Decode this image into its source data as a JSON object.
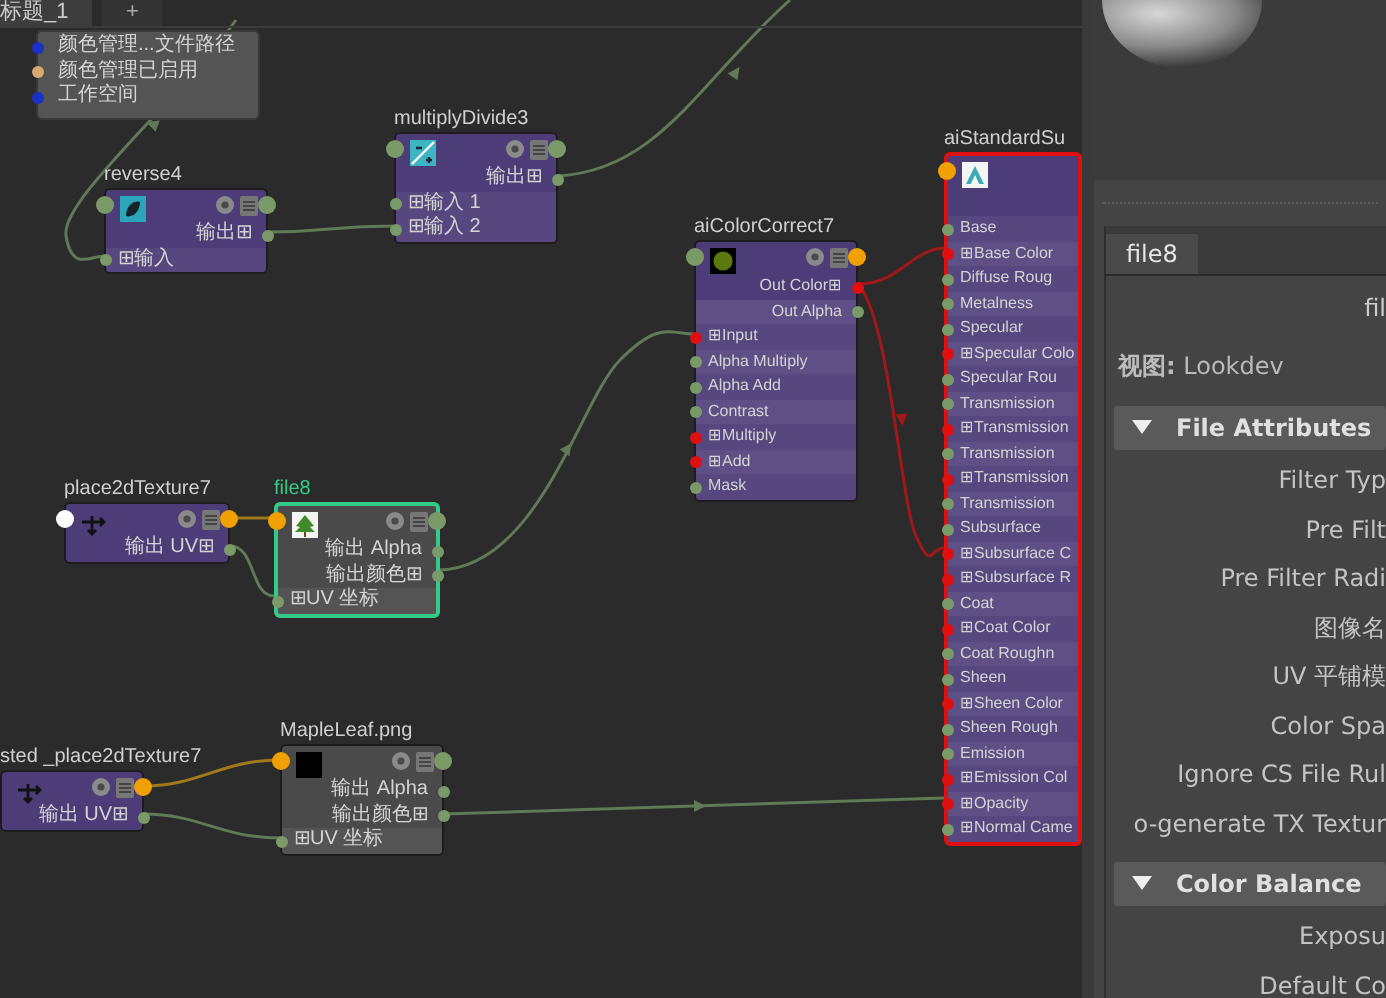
{
  "tabs": [
    {
      "label": "标题_1",
      "selected": true
    },
    {
      "label": "+",
      "selected": false
    }
  ],
  "nodes": [
    {
      "kind": "colorManagement",
      "selected": false,
      "inputs": [
        {
          "label": "颜色管理...文件路径",
          "color": "#1a30c8"
        },
        {
          "label": "颜色管理已启用",
          "color": "#d8a870"
        },
        {
          "label": "工作空间",
          "color": "#1a30c8"
        }
      ]
    },
    {
      "kind": "reverse",
      "title": "reverse4",
      "selected": false,
      "in_port": {
        "color": "#7a9a68"
      },
      "out_port": {
        "color": "#7a9a68"
      },
      "outputs": [
        {
          "label": "输出⊞",
          "color": "#7a9a68"
        }
      ],
      "inputs": [
        {
          "label": "⊞输入",
          "color": "#7a9a68"
        }
      ]
    },
    {
      "kind": "multiplyDivide",
      "title": "multiplyDivide3",
      "selected": false,
      "in_port": {
        "color": "#7a9a68"
      },
      "out_port": {
        "color": "#7a9a68"
      },
      "outputs": [
        {
          "label": "输出⊞",
          "color": "#7a9a68"
        }
      ],
      "inputs": [
        {
          "label": "⊞输入 1",
          "color": "#7a9a68"
        },
        {
          "label": "⊞输入 2",
          "color": "#7a9a68"
        }
      ]
    },
    {
      "kind": "place2dTexture",
      "title": "place2dTexture7",
      "selected": false,
      "in_port": {
        "color": "#ffffff"
      },
      "out_port": {
        "color": "#f0a000"
      },
      "outputs": [
        {
          "label": "输出 UV⊞",
          "color": "#7a9a68"
        }
      ]
    },
    {
      "kind": "file",
      "title": "file8",
      "selected": true,
      "in_port": {
        "color": "#f0a000"
      },
      "out_port": {
        "color": "#7a9a68"
      },
      "outputs": [
        {
          "label": "输出 Alpha",
          "color": "#7a9a68"
        },
        {
          "label": "输出颜色⊞",
          "color": "#7a9a68"
        }
      ],
      "inputs": [
        {
          "label": "⊞UV 坐标",
          "color": "#7a9a68"
        }
      ]
    },
    {
      "kind": "aiColorCorrect",
      "title": "aiColorCorrect7",
      "selected": false,
      "in_port": {
        "color": "#7a9a68"
      },
      "out_port": {
        "color": "#f0a000"
      },
      "outputs": [
        {
          "label": "Out Color⊞",
          "color": "#e01010"
        },
        {
          "label": "Out Alpha",
          "color": "#7a9a68"
        }
      ],
      "inputs": [
        {
          "label": "⊞Input",
          "color": "#e01010"
        },
        {
          "label": "Alpha Multiply",
          "color": "#7a9a68"
        },
        {
          "label": "Alpha Add",
          "color": "#7a9a68"
        },
        {
          "label": "Contrast",
          "color": "#7a9a68"
        },
        {
          "label": "⊞Multiply",
          "color": "#e01010"
        },
        {
          "label": "⊞Add",
          "color": "#e01010"
        },
        {
          "label": "Mask",
          "color": "#7a9a68"
        }
      ]
    },
    {
      "kind": "aiStandardSurface",
      "title": "aiStandardSu",
      "selected": false,
      "color": "#e01010",
      "in_port": {
        "color": "#f0a000"
      },
      "inputs": [
        {
          "label": "Base",
          "color": "#7a9a68"
        },
        {
          "label": "⊞Base Color",
          "color": "#e01010"
        },
        {
          "label": "Diffuse Roug",
          "color": "#7a9a68"
        },
        {
          "label": "Metalness",
          "color": "#7a9a68"
        },
        {
          "label": "Specular",
          "color": "#7a9a68"
        },
        {
          "label": "⊞Specular Colo",
          "color": "#e01010"
        },
        {
          "label": "Specular Rou",
          "color": "#7a9a68"
        },
        {
          "label": "Transmission",
          "color": "#7a9a68"
        },
        {
          "label": "⊞Transmission",
          "color": "#e01010"
        },
        {
          "label": "Transmission",
          "color": "#7a9a68"
        },
        {
          "label": "⊞Transmission",
          "color": "#e01010"
        },
        {
          "label": "Transmission",
          "color": "#7a9a68"
        },
        {
          "label": "Subsurface",
          "color": "#7a9a68"
        },
        {
          "label": "⊞Subsurface C",
          "color": "#e01010"
        },
        {
          "label": "⊞Subsurface R",
          "color": "#e01010"
        },
        {
          "label": "Coat",
          "color": "#7a9a68"
        },
        {
          "label": "⊞Coat Color",
          "color": "#e01010"
        },
        {
          "label": "Coat Roughn",
          "color": "#7a9a68"
        },
        {
          "label": "Sheen",
          "color": "#7a9a68"
        },
        {
          "label": "⊞Sheen Color",
          "color": "#e01010"
        },
        {
          "label": "Sheen Rough",
          "color": "#7a9a68"
        },
        {
          "label": "Emission",
          "color": "#7a9a68"
        },
        {
          "label": "⊞Emission Col",
          "color": "#e01010"
        },
        {
          "label": "⊞Opacity",
          "color": "#e01010"
        },
        {
          "label": "⊞Normal Came",
          "color": "#7a9a68"
        }
      ]
    },
    {
      "kind": "place2dTexture",
      "title": "sted _place2dTexture7",
      "selected": false,
      "out_port": {
        "color": "#f0a000"
      },
      "outputs": [
        {
          "label": "输出 UV⊞",
          "color": "#7a9a68"
        }
      ]
    },
    {
      "kind": "image",
      "title": "MapleLeaf.png",
      "selected": false,
      "in_port": {
        "color": "#f0a000"
      },
      "out_port": {
        "color": "#7a9a68"
      },
      "outputs": [
        {
          "label": "输出 Alpha",
          "color": "#7a9a68"
        },
        {
          "label": "输出颜色⊞",
          "color": "#7a9a68"
        }
      ],
      "inputs": [
        {
          "label": "⊞UV 坐标",
          "color": "#7a9a68"
        }
      ]
    }
  ],
  "attribute_editor": {
    "tabs": [
      {
        "label": "file8",
        "selected": true
      }
    ],
    "node_name": "fil",
    "view": "**视图:** Lookdev",
    "sections": [
      {
        "title": "File Attributes",
        "expanded": true,
        "attributes": [
          "Filter Typ",
          "Pre Filt",
          "Pre Filter Radi",
          "图像名",
          "UV 平铺模",
          "Color Spa",
          "Ignore CS File Rul",
          "o-generate TX Textur"
        ]
      },
      {
        "title": "Color Balance",
        "expanded": true,
        "attributes": [
          "Exposu",
          "Default Co"
        ]
      }
    ]
  }
}
